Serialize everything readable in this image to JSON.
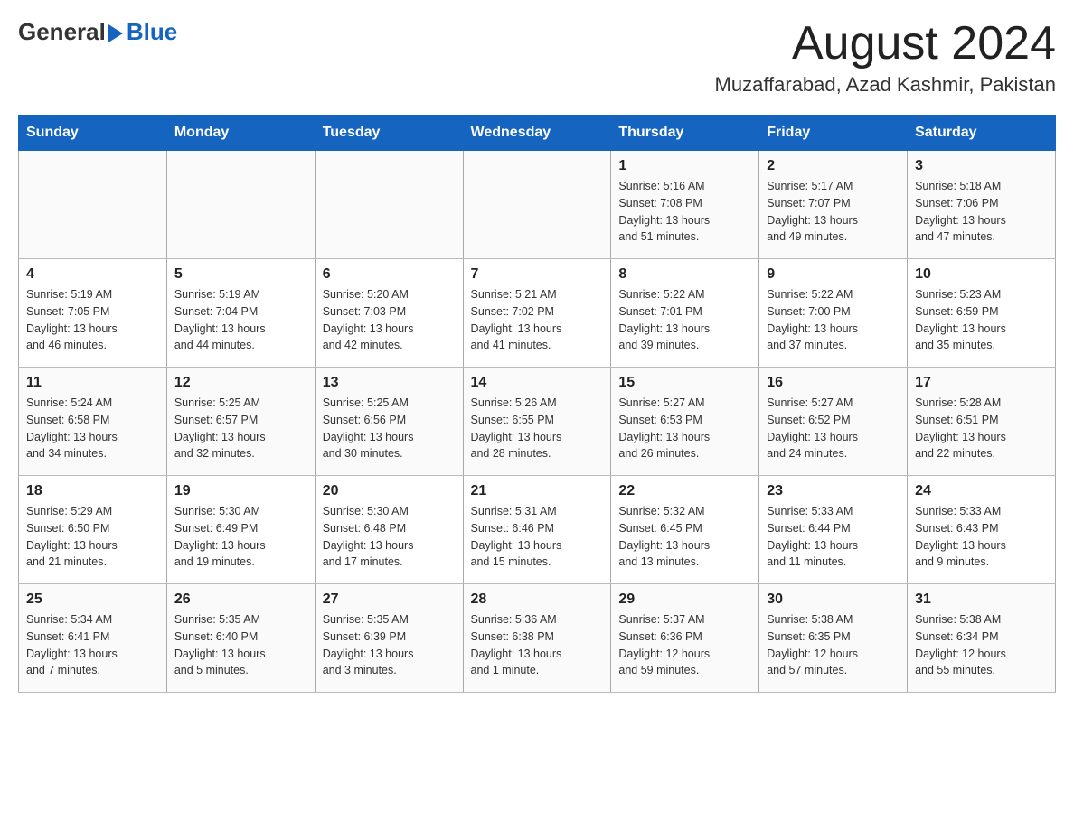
{
  "header": {
    "logo_text_general": "General",
    "logo_text_blue": "Blue",
    "title": "August 2024",
    "subtitle": "Muzaffarabad, Azad Kashmir, Pakistan"
  },
  "weekdays": [
    "Sunday",
    "Monday",
    "Tuesday",
    "Wednesday",
    "Thursday",
    "Friday",
    "Saturday"
  ],
  "weeks": [
    [
      {
        "day": "",
        "info": ""
      },
      {
        "day": "",
        "info": ""
      },
      {
        "day": "",
        "info": ""
      },
      {
        "day": "",
        "info": ""
      },
      {
        "day": "1",
        "info": "Sunrise: 5:16 AM\nSunset: 7:08 PM\nDaylight: 13 hours\nand 51 minutes."
      },
      {
        "day": "2",
        "info": "Sunrise: 5:17 AM\nSunset: 7:07 PM\nDaylight: 13 hours\nand 49 minutes."
      },
      {
        "day": "3",
        "info": "Sunrise: 5:18 AM\nSunset: 7:06 PM\nDaylight: 13 hours\nand 47 minutes."
      }
    ],
    [
      {
        "day": "4",
        "info": "Sunrise: 5:19 AM\nSunset: 7:05 PM\nDaylight: 13 hours\nand 46 minutes."
      },
      {
        "day": "5",
        "info": "Sunrise: 5:19 AM\nSunset: 7:04 PM\nDaylight: 13 hours\nand 44 minutes."
      },
      {
        "day": "6",
        "info": "Sunrise: 5:20 AM\nSunset: 7:03 PM\nDaylight: 13 hours\nand 42 minutes."
      },
      {
        "day": "7",
        "info": "Sunrise: 5:21 AM\nSunset: 7:02 PM\nDaylight: 13 hours\nand 41 minutes."
      },
      {
        "day": "8",
        "info": "Sunrise: 5:22 AM\nSunset: 7:01 PM\nDaylight: 13 hours\nand 39 minutes."
      },
      {
        "day": "9",
        "info": "Sunrise: 5:22 AM\nSunset: 7:00 PM\nDaylight: 13 hours\nand 37 minutes."
      },
      {
        "day": "10",
        "info": "Sunrise: 5:23 AM\nSunset: 6:59 PM\nDaylight: 13 hours\nand 35 minutes."
      }
    ],
    [
      {
        "day": "11",
        "info": "Sunrise: 5:24 AM\nSunset: 6:58 PM\nDaylight: 13 hours\nand 34 minutes."
      },
      {
        "day": "12",
        "info": "Sunrise: 5:25 AM\nSunset: 6:57 PM\nDaylight: 13 hours\nand 32 minutes."
      },
      {
        "day": "13",
        "info": "Sunrise: 5:25 AM\nSunset: 6:56 PM\nDaylight: 13 hours\nand 30 minutes."
      },
      {
        "day": "14",
        "info": "Sunrise: 5:26 AM\nSunset: 6:55 PM\nDaylight: 13 hours\nand 28 minutes."
      },
      {
        "day": "15",
        "info": "Sunrise: 5:27 AM\nSunset: 6:53 PM\nDaylight: 13 hours\nand 26 minutes."
      },
      {
        "day": "16",
        "info": "Sunrise: 5:27 AM\nSunset: 6:52 PM\nDaylight: 13 hours\nand 24 minutes."
      },
      {
        "day": "17",
        "info": "Sunrise: 5:28 AM\nSunset: 6:51 PM\nDaylight: 13 hours\nand 22 minutes."
      }
    ],
    [
      {
        "day": "18",
        "info": "Sunrise: 5:29 AM\nSunset: 6:50 PM\nDaylight: 13 hours\nand 21 minutes."
      },
      {
        "day": "19",
        "info": "Sunrise: 5:30 AM\nSunset: 6:49 PM\nDaylight: 13 hours\nand 19 minutes."
      },
      {
        "day": "20",
        "info": "Sunrise: 5:30 AM\nSunset: 6:48 PM\nDaylight: 13 hours\nand 17 minutes."
      },
      {
        "day": "21",
        "info": "Sunrise: 5:31 AM\nSunset: 6:46 PM\nDaylight: 13 hours\nand 15 minutes."
      },
      {
        "day": "22",
        "info": "Sunrise: 5:32 AM\nSunset: 6:45 PM\nDaylight: 13 hours\nand 13 minutes."
      },
      {
        "day": "23",
        "info": "Sunrise: 5:33 AM\nSunset: 6:44 PM\nDaylight: 13 hours\nand 11 minutes."
      },
      {
        "day": "24",
        "info": "Sunrise: 5:33 AM\nSunset: 6:43 PM\nDaylight: 13 hours\nand 9 minutes."
      }
    ],
    [
      {
        "day": "25",
        "info": "Sunrise: 5:34 AM\nSunset: 6:41 PM\nDaylight: 13 hours\nand 7 minutes."
      },
      {
        "day": "26",
        "info": "Sunrise: 5:35 AM\nSunset: 6:40 PM\nDaylight: 13 hours\nand 5 minutes."
      },
      {
        "day": "27",
        "info": "Sunrise: 5:35 AM\nSunset: 6:39 PM\nDaylight: 13 hours\nand 3 minutes."
      },
      {
        "day": "28",
        "info": "Sunrise: 5:36 AM\nSunset: 6:38 PM\nDaylight: 13 hours\nand 1 minute."
      },
      {
        "day": "29",
        "info": "Sunrise: 5:37 AM\nSunset: 6:36 PM\nDaylight: 12 hours\nand 59 minutes."
      },
      {
        "day": "30",
        "info": "Sunrise: 5:38 AM\nSunset: 6:35 PM\nDaylight: 12 hours\nand 57 minutes."
      },
      {
        "day": "31",
        "info": "Sunrise: 5:38 AM\nSunset: 6:34 PM\nDaylight: 12 hours\nand 55 minutes."
      }
    ]
  ]
}
